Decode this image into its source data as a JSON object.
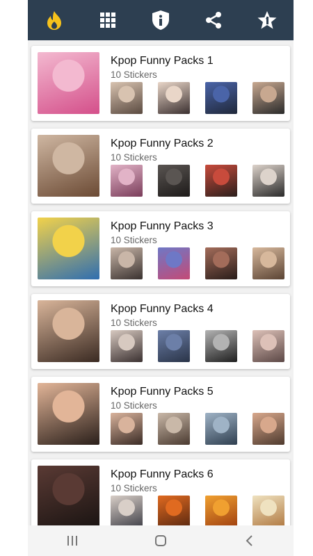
{
  "toolbar": {
    "icons": [
      "flame-icon",
      "grid-icon",
      "info-shield-icon",
      "share-icon",
      "star-icon"
    ],
    "accent": "#f6c21c",
    "background": "#2d3f51"
  },
  "packs": [
    {
      "title": "Kpop Funny Packs 1",
      "count": "10 Stickers",
      "cover": [
        "#f3b9d0",
        "#d44f8a"
      ],
      "thumbs": [
        [
          "#d8c3b0",
          "#5a4a40"
        ],
        [
          "#e9d6c8",
          "#3b3030"
        ],
        [
          "#4a64a8",
          "#20283a"
        ],
        [
          "#c8a890",
          "#2a2a2a"
        ]
      ]
    },
    {
      "title": "Kpop Funny Packs 2",
      "count": "10 Stickers",
      "cover": [
        "#cfb7a2",
        "#6b4a34"
      ],
      "thumbs": [
        [
          "#e2b3c7",
          "#7a3d5a"
        ],
        [
          "#5a5552",
          "#1d1a19"
        ],
        [
          "#c84b3c",
          "#2b1f1c"
        ],
        [
          "#ddd3cb",
          "#2a2a2a"
        ]
      ]
    },
    {
      "title": "Kpop Funny Packs 3",
      "count": "10 Stickers",
      "cover": [
        "#f2d24a",
        "#2f6eb0"
      ],
      "thumbs": [
        [
          "#c9b6a8",
          "#3a3230"
        ],
        [
          "#6e78c6",
          "#c44a76"
        ],
        [
          "#a36c5a",
          "#2a1d1a"
        ],
        [
          "#d7b89c",
          "#5b4434"
        ]
      ]
    },
    {
      "title": "Kpop Funny Packs 4",
      "count": "10 Stickers",
      "cover": [
        "#d9b59a",
        "#3a2a22"
      ],
      "thumbs": [
        [
          "#d7c9c0",
          "#3b3131"
        ],
        [
          "#6c7fa8",
          "#2a3448"
        ],
        [
          "#b3b3b3",
          "#1f1f1f"
        ],
        [
          "#ddc1b8",
          "#5c4846"
        ]
      ]
    },
    {
      "title": "Kpop Funny Packs 5",
      "count": "10 Stickers",
      "cover": [
        "#e2b598",
        "#2a1f1a"
      ],
      "thumbs": [
        [
          "#d9b39c",
          "#3a2b25"
        ],
        [
          "#c9b8a8",
          "#4a3a30"
        ],
        [
          "#9fb3c6",
          "#2f3f50"
        ],
        [
          "#d8a88c",
          "#4f3a2e"
        ]
      ]
    },
    {
      "title": "Kpop Funny Packs 6",
      "count": "10 Stickers",
      "cover": [
        "#5a3a34",
        "#1a1412"
      ],
      "thumbs": [
        [
          "#d9cfc8",
          "#404048"
        ],
        [
          "#e06a20",
          "#5a2810"
        ],
        [
          "#f0a030",
          "#a04010"
        ],
        [
          "#efe2c0",
          "#b07840"
        ]
      ]
    }
  ],
  "navbar": {
    "icons": [
      "recent-apps-icon",
      "home-icon",
      "back-icon"
    ]
  }
}
